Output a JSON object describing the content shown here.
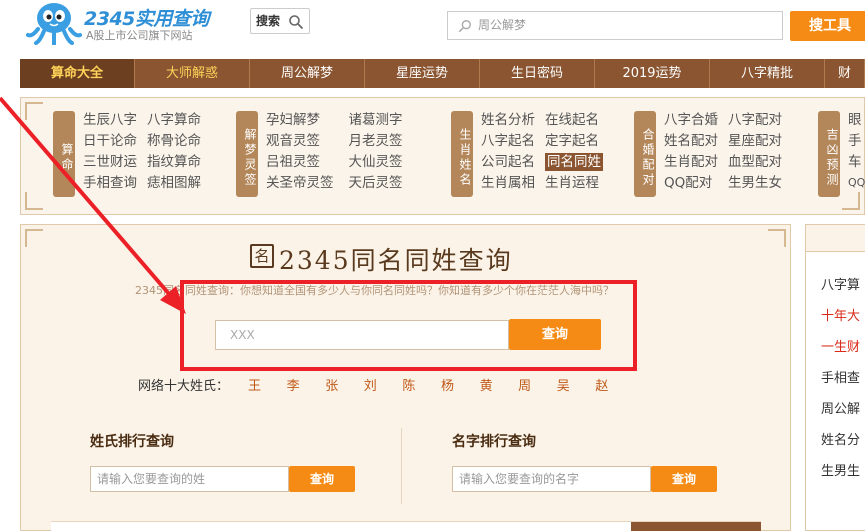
{
  "header": {
    "logo_brand_num": "2345",
    "logo_brand_text": "实用查询",
    "logo_sub": "A股上市公司旗下网站",
    "search_label": "搜索",
    "search_placeholder": "周公解梦",
    "tool_button": "搜工具"
  },
  "nav": {
    "items": [
      {
        "label": "算命大全",
        "state": "active"
      },
      {
        "label": "大师解惑",
        "state": "gold"
      },
      {
        "label": "周公解梦",
        "state": ""
      },
      {
        "label": "星座运势",
        "state": ""
      },
      {
        "label": "生日密码",
        "state": ""
      },
      {
        "label": "2019运势",
        "state": ""
      },
      {
        "label": "八字精批",
        "state": ""
      },
      {
        "label": "财",
        "state": ""
      }
    ]
  },
  "categories": [
    {
      "tag": "算命",
      "links": [
        "生辰八字",
        "八字算命",
        "日干论命",
        "称骨论命",
        "三世财运",
        "指纹算命",
        "手相查询",
        "痣相图解"
      ]
    },
    {
      "tag": "解梦灵签",
      "links": [
        "孕妇解梦",
        "诸葛测字",
        "观音灵签",
        "月老灵签",
        "吕祖灵签",
        "大仙灵签",
        "关圣帝灵签",
        "天后灵签"
      ]
    },
    {
      "tag": "生肖姓名",
      "links": [
        "姓名分析",
        "在线起名",
        "八字起名",
        "定字起名",
        "公司起名",
        "同名同姓",
        "生肖属相",
        "生肖运程"
      ]
    },
    {
      "tag": "合婚配对",
      "links": [
        "八字合婚",
        "八字配对",
        "姓名配对",
        "星座配对",
        "生肖配对",
        "血型配对",
        "QQ配对",
        "生男生女"
      ]
    },
    {
      "tag": "吉凶预测",
      "links": [
        "眼",
        "手",
        "车",
        "QQ"
      ]
    }
  ],
  "main": {
    "title_icon": "名",
    "title": "2345同名同姓查询",
    "subtitle": "2345同名同姓查询：你想知道全国有多少人与你同名同姓吗？你知道有多少个你在茫茫人海中吗？",
    "query_value": "XXX",
    "query_button": "查询",
    "top_surnames_label": "网络十大姓氏：",
    "top_surnames": [
      "王",
      "李",
      "张",
      "刘",
      "陈",
      "杨",
      "黄",
      "周",
      "吴",
      "赵"
    ],
    "surname_rank": {
      "label": "姓氏排行查询",
      "placeholder": "请输入您要查询的姓",
      "button": "查询"
    },
    "name_rank": {
      "label": "名字排行查询",
      "placeholder": "请输入您要查询的名字",
      "button": "查询"
    }
  },
  "right_list": [
    {
      "label": "八字算",
      "color": "normal"
    },
    {
      "label": "十年大",
      "color": "red"
    },
    {
      "label": "一生财",
      "color": "red"
    },
    {
      "label": "手相查",
      "color": "normal"
    },
    {
      "label": "周公解",
      "color": "normal"
    },
    {
      "label": "姓名分",
      "color": "normal"
    },
    {
      "label": "生男生",
      "color": "normal"
    }
  ],
  "colors": {
    "brand_blue": "#2e8fd6",
    "nav_brown": "#8a5530",
    "accent_orange": "#f58b14",
    "annotation_red": "#ec2127",
    "panel_bg": "#fbf4ea"
  }
}
